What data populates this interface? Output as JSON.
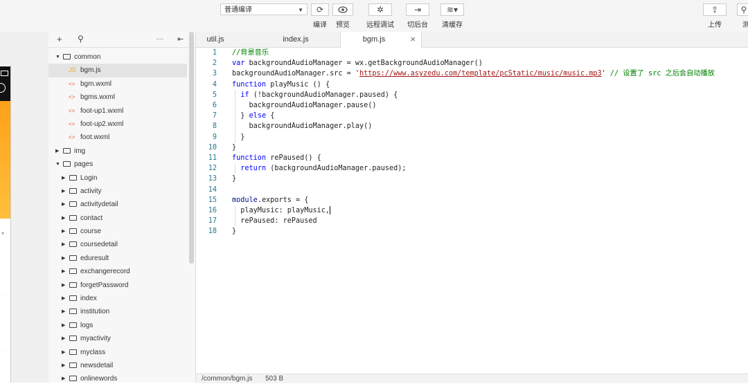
{
  "toolbar": {
    "compile_mode": "普通编译",
    "compile_label": "编译",
    "preview_label": "预览",
    "remote_debug_label": "远程调试",
    "background_label": "切后台",
    "clear_cache_label": "清缓存",
    "upload_label": "上传",
    "test_label": "测"
  },
  "explorer": {
    "items": [
      {
        "label": "common",
        "type": "folder",
        "expanded": true,
        "depth": 0
      },
      {
        "label": "bgm.js",
        "type": "js",
        "depth": 1,
        "active": true
      },
      {
        "label": "bgm.wxml",
        "type": "wxml",
        "depth": 1
      },
      {
        "label": "bgms.wxml",
        "type": "wxml",
        "depth": 1
      },
      {
        "label": "foot-up1.wxml",
        "type": "wxml",
        "depth": 1
      },
      {
        "label": "foot-up2.wxml",
        "type": "wxml",
        "depth": 1
      },
      {
        "label": "foot.wxml",
        "type": "wxml",
        "depth": 1
      },
      {
        "label": "img",
        "type": "folder",
        "expanded": false,
        "depth": 0
      },
      {
        "label": "pages",
        "type": "folder",
        "expanded": true,
        "depth": 0
      },
      {
        "label": "Login",
        "type": "folder",
        "expanded": false,
        "depth": 1
      },
      {
        "label": "activity",
        "type": "folder",
        "expanded": false,
        "depth": 1
      },
      {
        "label": "activitydetail",
        "type": "folder",
        "expanded": false,
        "depth": 1
      },
      {
        "label": "contact",
        "type": "folder",
        "expanded": false,
        "depth": 1
      },
      {
        "label": "course",
        "type": "folder",
        "expanded": false,
        "depth": 1
      },
      {
        "label": "coursedetail",
        "type": "folder",
        "expanded": false,
        "depth": 1
      },
      {
        "label": "eduresult",
        "type": "folder",
        "expanded": false,
        "depth": 1
      },
      {
        "label": "exchangerecord",
        "type": "folder",
        "expanded": false,
        "depth": 1
      },
      {
        "label": "forgetPassword",
        "type": "folder",
        "expanded": false,
        "depth": 1
      },
      {
        "label": "index",
        "type": "folder",
        "expanded": false,
        "depth": 1
      },
      {
        "label": "institution",
        "type": "folder",
        "expanded": false,
        "depth": 1
      },
      {
        "label": "logs",
        "type": "folder",
        "expanded": false,
        "depth": 1
      },
      {
        "label": "myactivity",
        "type": "folder",
        "expanded": false,
        "depth": 1
      },
      {
        "label": "myclass",
        "type": "folder",
        "expanded": false,
        "depth": 1
      },
      {
        "label": "newsdetail",
        "type": "folder",
        "expanded": false,
        "depth": 1
      },
      {
        "label": "onlinewords",
        "type": "folder",
        "expanded": false,
        "depth": 1
      }
    ]
  },
  "tabs": [
    {
      "label": "util.js",
      "active": false
    },
    {
      "label": "index.js",
      "active": false
    },
    {
      "label": "bgm.js",
      "active": true
    }
  ],
  "code_lines": [
    "//背景音乐",
    "var backgroundAudioManager = wx.getBackgroundAudioManager()",
    "backgroundAudioManager.src = 'https://www.asyzedu.com/template/pcStatic/music/music.mp3' // 设置了 src 之后会自动播放",
    "function playMusic () {",
    "  if (!backgroundAudioManager.paused) {",
    "    backgroundAudioManager.pause()",
    "  } else {",
    "    backgroundAudioManager.play()",
    "  }",
    "}",
    "function rePaused() {",
    "  return (backgroundAudioManager.paused);",
    "}",
    "",
    "module.exports = {",
    "  playMusic: playMusic,",
    "  rePaused: rePaused",
    "}"
  ],
  "status": {
    "path": "/common/bgm.js",
    "size": "503 B"
  }
}
